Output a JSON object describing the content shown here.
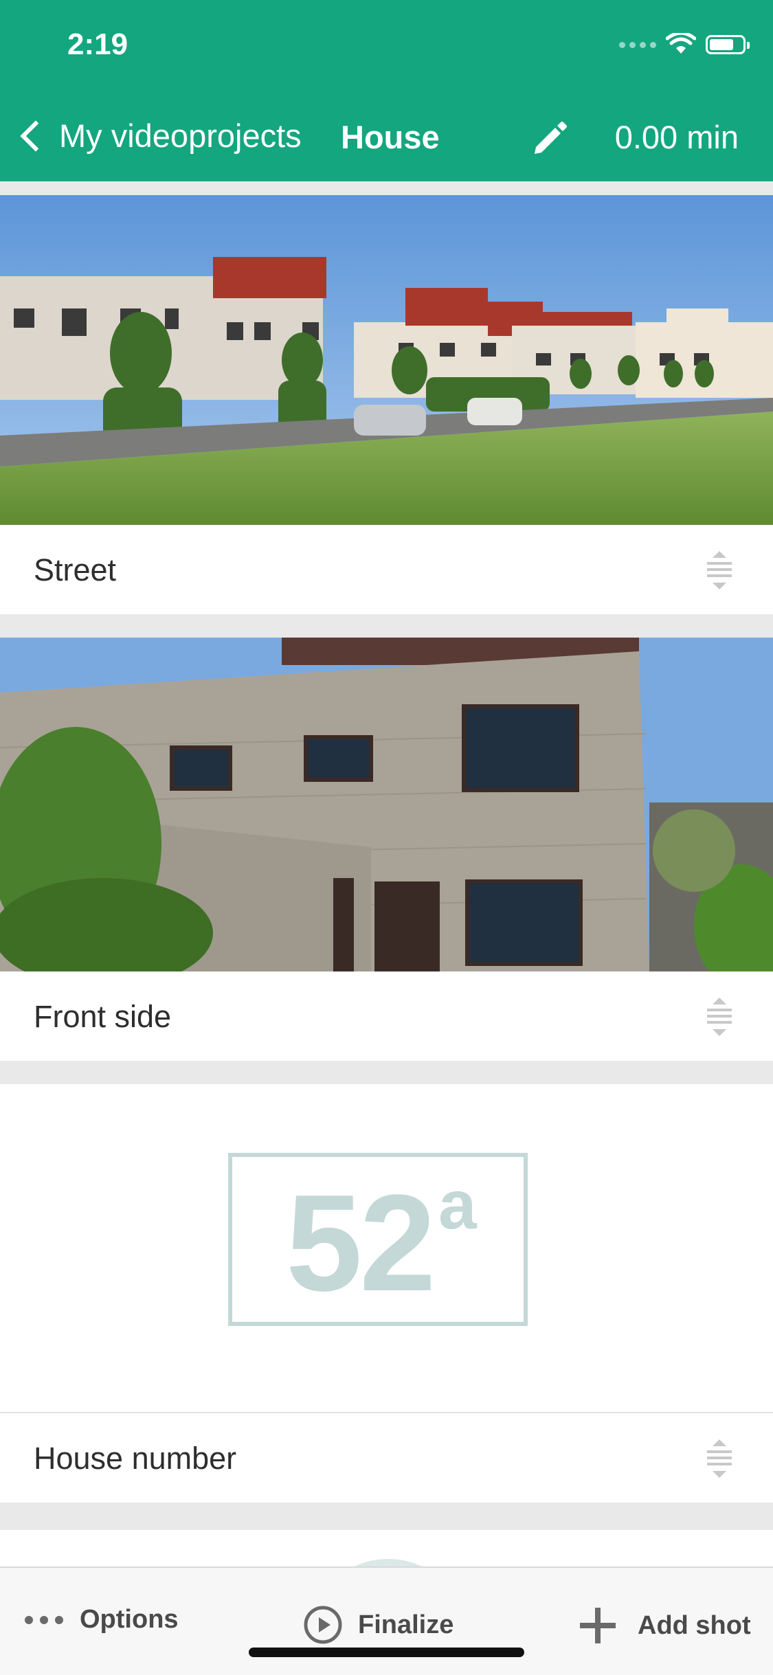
{
  "status_bar": {
    "time": "2:19"
  },
  "nav": {
    "back_label": "My videoprojects",
    "title": "House",
    "duration": "0.00 min"
  },
  "shots": [
    {
      "label": "Street"
    },
    {
      "label": "Front side"
    },
    {
      "label": "House number",
      "placeholder_number": "52",
      "placeholder_superscript": "a"
    }
  ],
  "toolbar": {
    "options_label": "Options",
    "finalize_label": "Finalize",
    "add_shot_label": "Add shot"
  },
  "colors": {
    "accent": "#14a67f",
    "placeholder": "#c3d8d7",
    "separator": "#e9e9e9"
  },
  "icons": [
    "back-chevron-icon",
    "pencil-icon",
    "drag-handle-icon",
    "more-dots-icon",
    "play-circle-icon",
    "plus-icon",
    "wifi-icon",
    "battery-icon",
    "signal-icon"
  ]
}
